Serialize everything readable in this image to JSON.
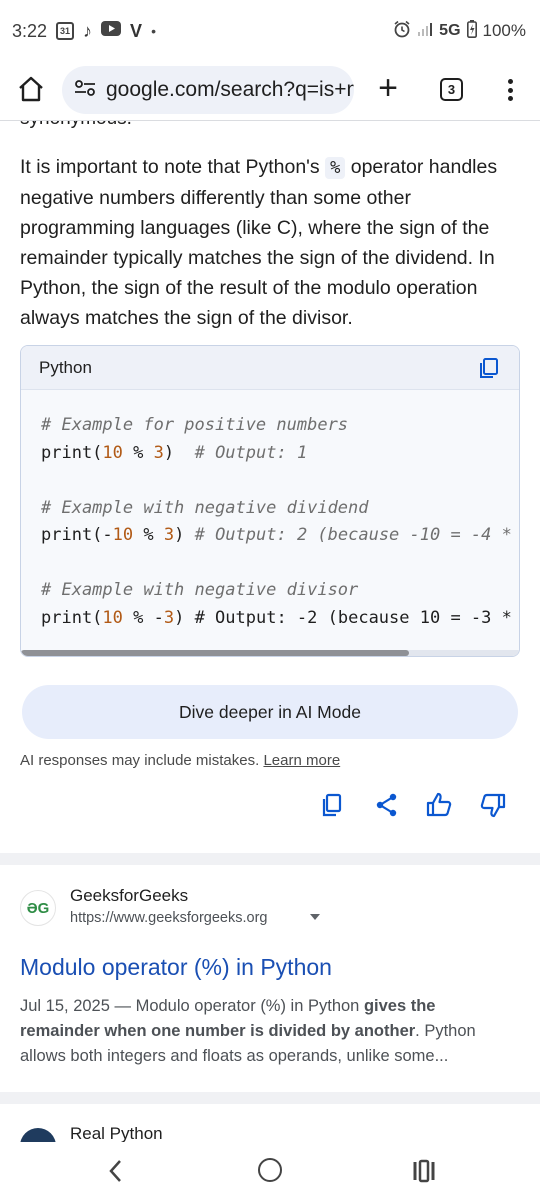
{
  "status_bar": {
    "time": "3:22",
    "calendar_day": "31",
    "network": "5G",
    "battery": "100%"
  },
  "browser": {
    "url": "google.com/search?q=is+m",
    "tab_count": "3"
  },
  "content": {
    "cut_off_text": "synonymous.",
    "paragraph": {
      "before_code": "It is important to note that Python's ",
      "inline_code": "%",
      "after_code": " operator handles negative numbers differently than some other programming languages (like C), where the sign of the remainder typically matches the sign of the dividend. In Python, the sign of the result of the modulo operation always matches the sign of the divisor."
    },
    "code_block": {
      "language": "Python",
      "lines": {
        "c1": "# Example for positive numbers",
        "l1_a": "print(",
        "l1_n1": "10",
        "l1_b": " % ",
        "l1_n2": "3",
        "l1_c": ")  ",
        "l1_cm": "# Output: 1",
        "c2": "# Example with negative dividend",
        "l2_a": "print(-",
        "l2_n1": "10",
        "l2_b": " % ",
        "l2_n2": "3",
        "l2_c": ") ",
        "l2_cm": "# Output: 2 (because -10 = -4 *",
        "c3": "# Example with negative divisor",
        "l3_a": "print(",
        "l3_n1": "10",
        "l3_b": " % -",
        "l3_n2": "3",
        "l3_c": ") # Output: -2 (because 10 = -3 *"
      }
    },
    "dive_deeper_label": "Dive deeper in AI Mode",
    "disclaimer": "AI responses may include mistakes.",
    "learn_more": "Learn more"
  },
  "results": [
    {
      "site_name": "GeeksforGeeks",
      "site_url": "https://www.geeksforgeeks.org",
      "logo_text": "ƏG",
      "title": "Modulo operator (%) in Python",
      "snippet_date": "Jul 15, 2025 — Modulo operator (%) in Python ",
      "snippet_bold": "gives the remainder when one number is divided by another",
      "snippet_rest": ". Python allows both integers and floats as operands, unlike some..."
    },
    {
      "site_name": "Real Python"
    }
  ],
  "colors": {
    "link_blue": "#1a4fb3",
    "icon_blue": "#0b57d0",
    "geeks_green": "#2f8d46"
  }
}
